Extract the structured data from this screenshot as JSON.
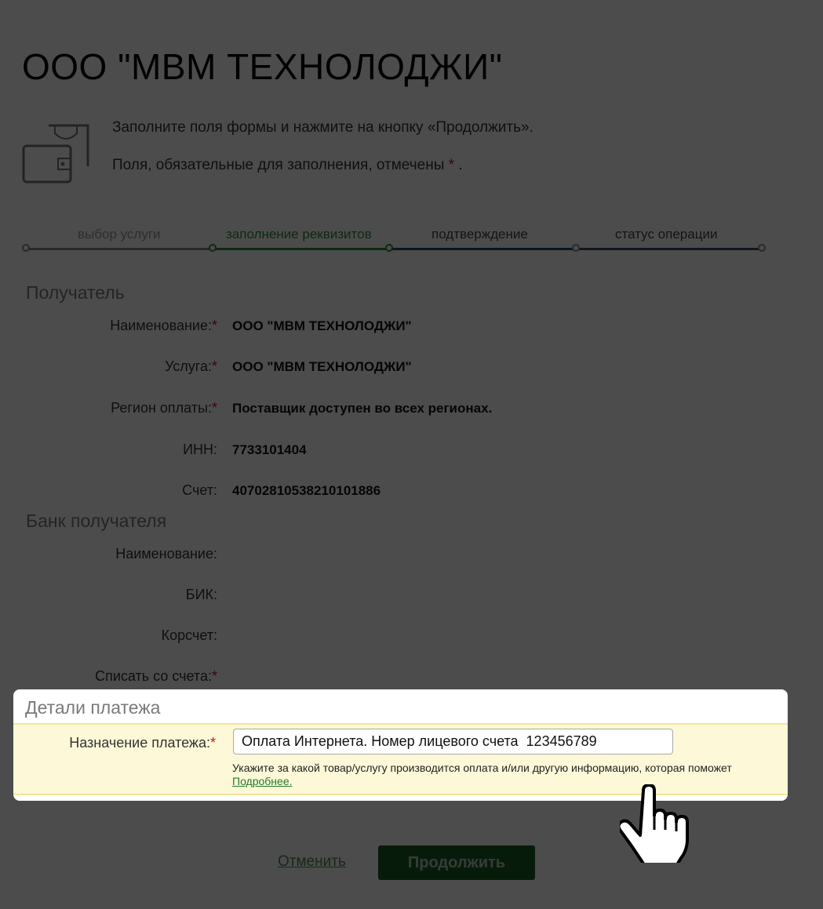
{
  "page": {
    "title": "ООО \"МВМ ТЕХНОЛОДЖИ\"",
    "intro_line1": "Заполните поля формы и нажмите на кнопку «Продолжить».",
    "intro_line2": "Поля, обязательные для заполнения, отмечены",
    "required_mark": "*",
    "intro_tail": ".",
    "icon": "wallet-icon"
  },
  "steps": [
    {
      "label": "выбор услуги",
      "state": "done"
    },
    {
      "label": "заполнение реквизитов",
      "state": "active"
    },
    {
      "label": "подтверждение",
      "state": "pending"
    },
    {
      "label": "статус операции",
      "state": "pending"
    }
  ],
  "recipient": {
    "heading": "Получатель",
    "rows": [
      {
        "label": "Наименование:",
        "required": "*",
        "value": "ООО \"МВМ ТЕХНОЛОДЖИ\""
      },
      {
        "label": "Услуга:",
        "required": "*",
        "value": "ООО \"МВМ ТЕХНОЛОДЖИ\""
      },
      {
        "label": "Регион оплаты:",
        "required": "*",
        "value": "Поставщик доступен во всех регионах."
      },
      {
        "label": "ИНН:",
        "value": "7733101404"
      },
      {
        "label": "Счет:",
        "value": "40702810538210101886"
      }
    ]
  },
  "bank": {
    "heading": "Банк получателя",
    "rows": [
      {
        "label": "Наименование:"
      },
      {
        "label": "БИК:"
      },
      {
        "label": "Корсчет:"
      },
      {
        "label": "Списать со счета:",
        "required": "*"
      }
    ]
  },
  "details": {
    "heading": "Детали платежа",
    "purpose_label": "Назначение платежа:",
    "purpose_required": "*",
    "purpose_value": "Оплата Интернета. Номер лицевого счета  123456789",
    "hint_text": "Укажите за какой товар/услугу производится оплата и/или другую информацию, которая поможет",
    "hint_link": "Подробнее."
  },
  "actions": {
    "cancel_label": "Отменить",
    "continue_label": "Продолжить"
  },
  "colors": {
    "accent_green": "#1a5c25",
    "active_step": "#2f8a3a",
    "required": "#c7141a",
    "highlight_bg": "#fdf9d8"
  }
}
